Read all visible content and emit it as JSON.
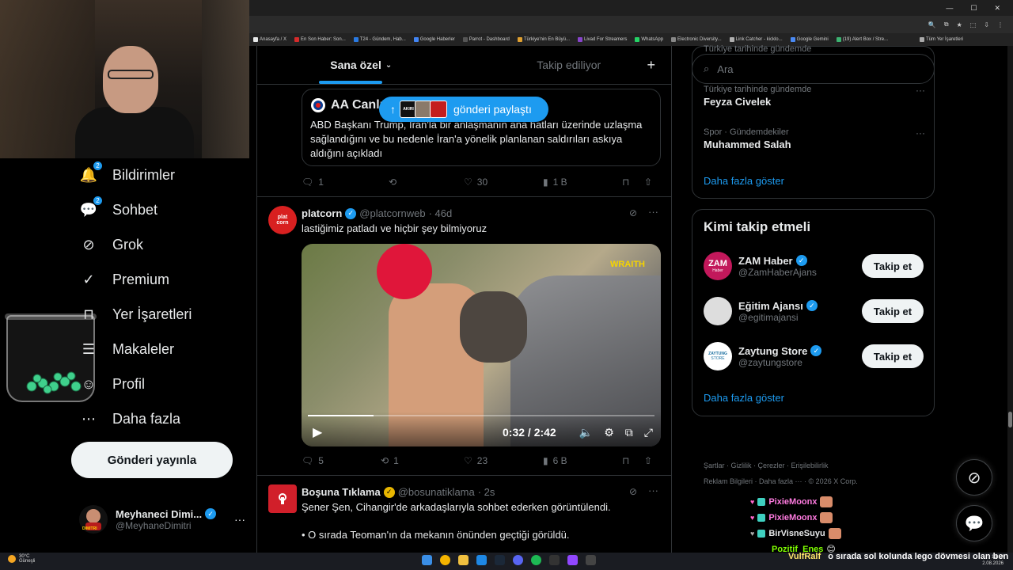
{
  "browser": {
    "bookmarks": [
      "Anasayfa / X",
      "En Son Haber: Son...",
      "T24 - Gündem, Hab...",
      "Google Haberler",
      "Parrot - Dashboard",
      "Türkiye'nin En Büyü...",
      "Livad For Streamers",
      "WhatsApp",
      "Electronic Diversity...",
      "Link Catcher - kicklo...",
      "Google Gemini",
      "(19) Alert Box / Stre...",
      "Tüm Yer İşaretleri"
    ],
    "bookmark_colors": [
      "#e7e9ea",
      "#d62b2b",
      "#2a7ae2",
      "#4285f4",
      "#555555",
      "#e0a030",
      "#8844cc",
      "#25d366",
      "#888888",
      "#b0b0b0",
      "#4a8af4",
      "#3cb371",
      "#aaaaaa"
    ]
  },
  "nav": {
    "items": [
      {
        "label": "Bildirimler",
        "icon": "bell-icon",
        "badge": "2"
      },
      {
        "label": "Sohbet",
        "icon": "chat-icon",
        "badge": "2"
      },
      {
        "label": "Grok",
        "icon": "grok-icon",
        "badge": ""
      },
      {
        "label": "Premium",
        "icon": "premium-icon",
        "badge": ""
      },
      {
        "label": "Yer İşaretleri",
        "icon": "bookmark-icon",
        "badge": ""
      },
      {
        "label": "Makaleler",
        "icon": "article-icon",
        "badge": ""
      },
      {
        "label": "Profil",
        "icon": "profile-icon",
        "badge": ""
      },
      {
        "label": "Daha fazla",
        "icon": "more-circle-icon",
        "badge": ""
      }
    ],
    "post_button": "Gönderi yayınla",
    "profile_name": "Meyhaneci Dimi...",
    "profile_handle": "@MeyhaneDimitri",
    "avatar_caption": "DIMITRI"
  },
  "tabs": {
    "for_you": "Sana özel",
    "following": "Takip ediliyor",
    "plus": "+"
  },
  "share_pill": {
    "label": "gönderi paylaştı",
    "thumb_text": "AKIRI"
  },
  "quote": {
    "name": "AA Canlı",
    "text": "ABD Başkanı Trump, İran'la bir anlaşmanın ana hatları üzerinde uzlaşma sağlandığını ve bu nedenle İran'a yönelik planlanan saldırıları askıya aldığını açıkladı",
    "actions": {
      "replies": "1",
      "likes": "30",
      "views": "1 B"
    }
  },
  "tweet2": {
    "name": "platcorn",
    "handle": "@platcornweb",
    "time": "· 46d",
    "text": "lastiğimiz patladı ve hiçbir şey bilmiyoruz",
    "video_time": "0:32 / 2:42",
    "video_progress": 0.19,
    "watermark": "WRAITH",
    "avatar_text": "plat corn",
    "actions": {
      "replies": "5",
      "reposts": "1",
      "likes": "23",
      "views": "6 B"
    }
  },
  "tweet3": {
    "name": "Boşuna Tıklama",
    "handle": "@bosunatiklama",
    "time": "· 2s",
    "text1": "Şener Şen, Cihangir'de arkadaşlarıyla sohbet ederken görüntülendi.",
    "text2": "• O sırada Teoman'ın da mekanın önünden geçtiği görüldü."
  },
  "search": {
    "placeholder": "Ara"
  },
  "trends": [
    {
      "category": "Türkiye tarihinde gündemde",
      "name": "Feyza Civelek"
    },
    {
      "category": "Spor · Gündemdekiler",
      "name": "Muhammed Salah"
    }
  ],
  "trend_top_cut": "Türkiye tarihinde gündemde",
  "trends_more": "Daha fazla göster",
  "who_to_follow": {
    "title": "Kimi takip etmeli",
    "accounts": [
      {
        "name": "ZAM Haber",
        "handle": "@ZamHaberAjans",
        "avatar_text": "ZAM",
        "avatar_sub": "Haber",
        "color": "#c2185b"
      },
      {
        "name": "Eğitim Ajansı",
        "handle": "@egitimajansi",
        "avatar_text": "",
        "avatar_sub": "",
        "color": "#dddddd"
      },
      {
        "name": "Zaytung Store",
        "handle": "@zaytungstore",
        "avatar_text": "ZAYTUNG",
        "avatar_sub": "STORE",
        "color": "#ffffff"
      }
    ],
    "follow_label": "Takip et",
    "more": "Daha fazla göster"
  },
  "footer": {
    "links": [
      "Şartlar",
      "Gizlilik",
      "Çerezler",
      "Erişilebilirlik",
      "Reklam Bilgileri",
      "Daha fazla ···",
      "© 2026 X Corp."
    ]
  },
  "chat_overlay": [
    {
      "user": "PixieMoonx",
      "color": "#ff7be0"
    },
    {
      "user": "PixieMoonx",
      "color": "#ff7be0"
    },
    {
      "user": "BirVisneSuyu",
      "color": "#e7e9ea"
    },
    {
      "user": "Pozitif_Enes",
      "color": "#7fff00"
    }
  ],
  "overlay_message": {
    "user": "VulfRalf",
    "text": "o sırada sol kolunda lego dövmesi olan ben"
  },
  "taskbar": {
    "weather_temp": "30°C",
    "weather_desc": "Güneşli",
    "time": "13:19",
    "date": "2.08.2026"
  }
}
